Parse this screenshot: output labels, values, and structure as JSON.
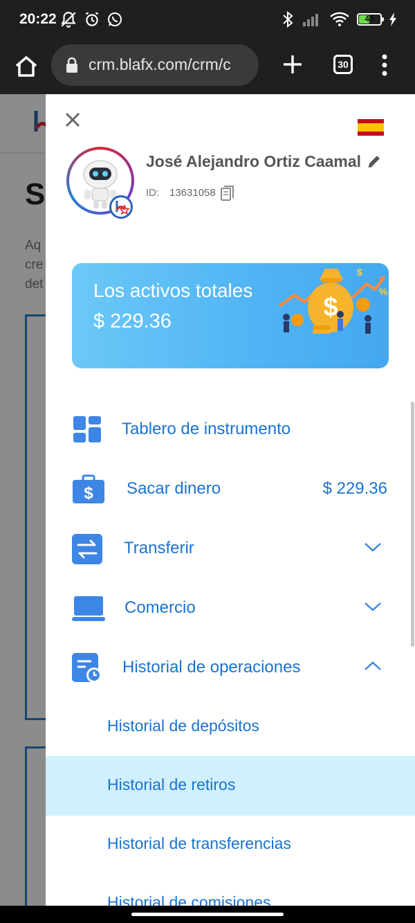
{
  "status_bar": {
    "time": "20:22",
    "battery": "49",
    "battery_level": 0.49
  },
  "browser": {
    "url": "crm.blafx.com/crm/c",
    "tab_count": "30"
  },
  "drawer": {
    "user": {
      "name": "José Alejandro Ortiz Caamal",
      "id_label": "ID:",
      "id_value": "13631058"
    },
    "assets": {
      "title": "Los activos totales",
      "value": "$ 229.36"
    },
    "menu": {
      "dashboard": "Tablero de instrumento",
      "withdraw": "Sacar dinero",
      "withdraw_amount": "$ 229.36",
      "transfer": "Transferir",
      "commerce": "Comercio",
      "history": "Historial de operaciones"
    },
    "history_submenu": {
      "deposits": "Historial de depósitos",
      "withdrawals": "Historial de retiros",
      "transfers": "Historial de transferencias",
      "commissions": "Historial de comisiones"
    }
  },
  "colors": {
    "accent": "#1a73d0",
    "active_row": "#d0f0fd",
    "card": "#4fb3f4"
  }
}
